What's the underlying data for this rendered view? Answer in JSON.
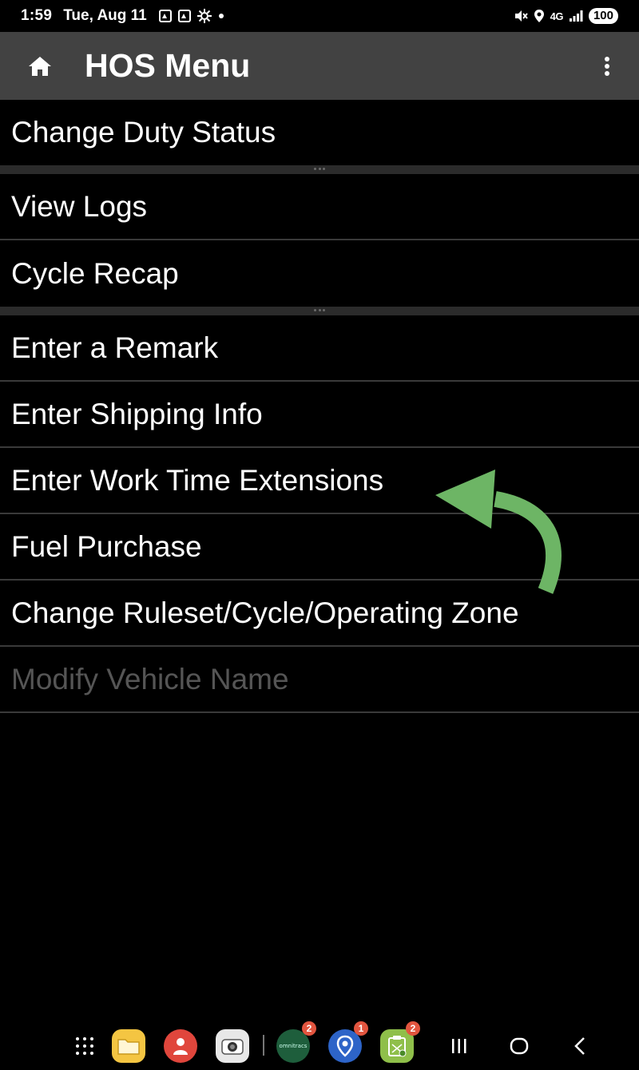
{
  "status_bar": {
    "time": "1:59",
    "date": "Tue, Aug 11",
    "network": "4G",
    "battery": "100",
    "icons": [
      "notification-app-icon",
      "notification-app-icon",
      "gear-icon",
      "dot-icon",
      "mute-icon",
      "location-icon",
      "signal-icon"
    ]
  },
  "app_bar": {
    "title": "HOS Menu",
    "home_icon": "home-icon",
    "overflow_icon": "more-vert-icon"
  },
  "menu": {
    "groups": [
      [
        "Change Duty Status"
      ],
      [
        "View Logs",
        "Cycle Recap"
      ],
      [
        "Enter a Remark",
        "Enter Shipping Info",
        "Enter Work Time Extensions",
        "Fuel Purchase",
        "Change Ruleset/Cycle/Operating Zone",
        "Modify Vehicle Name"
      ]
    ],
    "disabled_item": "Modify Vehicle Name",
    "highlighted_item": "Enter Work Time Extensions"
  },
  "annotation": {
    "type": "curved-arrow",
    "color": "#6db565",
    "points_to": "Enter Work Time Extensions"
  },
  "dock": {
    "apps": [
      {
        "name": "apps-grid",
        "badge": null
      },
      {
        "name": "files",
        "color": "#f4c542",
        "badge": null
      },
      {
        "name": "contacts",
        "color": "#e0463c",
        "badge": null
      },
      {
        "name": "camera",
        "color": "#e8e8e8",
        "badge": null
      },
      {
        "name": "omnitracs",
        "label": "omnitracs",
        "color": "#1e5e3c",
        "badge": "2"
      },
      {
        "name": "navigation",
        "color": "#2d64c8",
        "badge": "1"
      },
      {
        "name": "hos-app",
        "color": "#8fbf4a",
        "badge": "2"
      }
    ],
    "nav_buttons": [
      "recents-icon",
      "home-circle-icon",
      "back-icon"
    ]
  }
}
